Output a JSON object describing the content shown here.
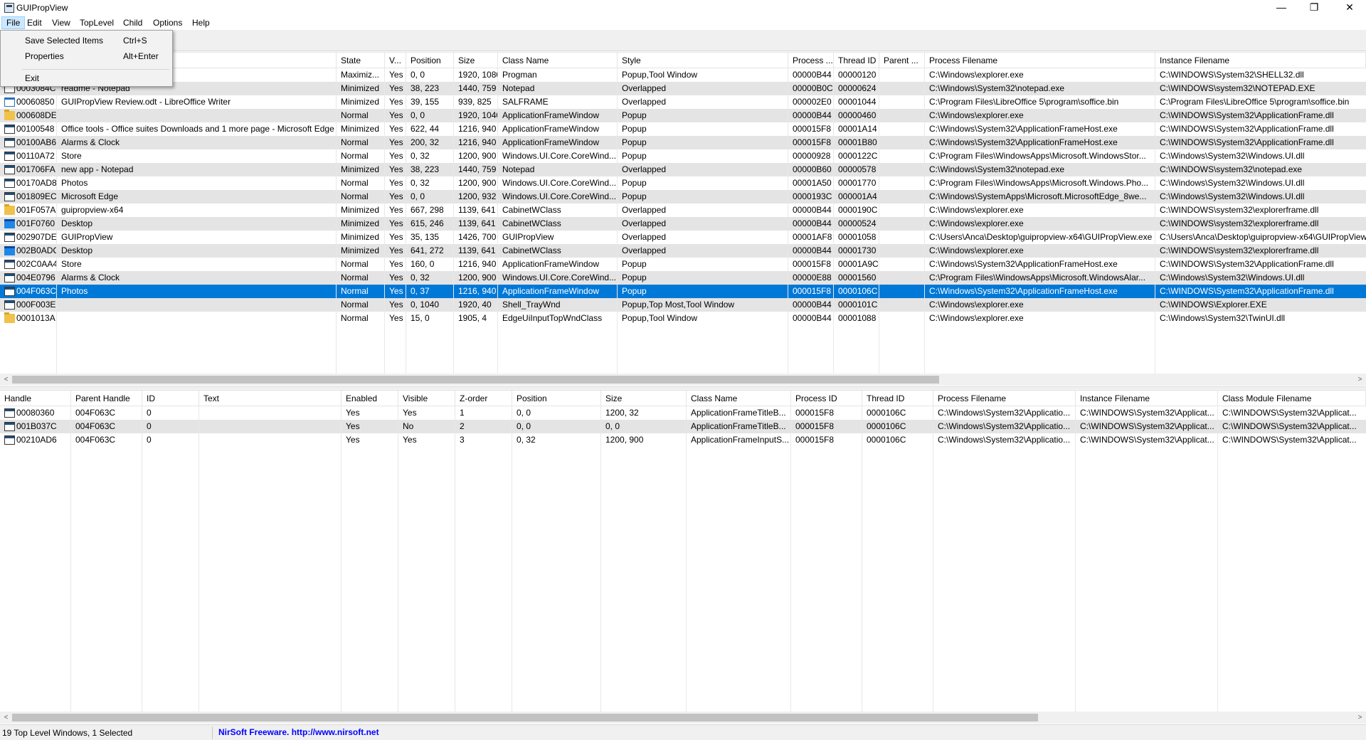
{
  "window": {
    "title": "GUIPropView",
    "minimize_glyph": "—",
    "maximize_glyph": "❐",
    "close_glyph": "✕"
  },
  "menubar": [
    "File",
    "Edit",
    "View",
    "TopLevel",
    "Child",
    "Options",
    "Help"
  ],
  "file_menu": {
    "items": [
      {
        "label": "Save Selected Items",
        "shortcut": "Ctrl+S"
      },
      {
        "label": "Properties",
        "shortcut": "Alt+Enter"
      },
      {
        "label": "Exit",
        "shortcut": ""
      }
    ]
  },
  "top_list": {
    "columns": [
      "",
      "",
      "State",
      "V...",
      "Position",
      "Size",
      "Class Name",
      "Style",
      "Process ...",
      "Thread ID",
      "Parent ...",
      "Process Filename",
      "Instance Filename"
    ],
    "rows": [
      {
        "icon": "window",
        "handle": "",
        "title": "",
        "state": "Maximiz...",
        "visible": "Yes",
        "position": "0, 0",
        "size": "1920, 1080",
        "class": "Progman",
        "style": "Popup,Tool Window",
        "pid": "00000B44",
        "tid": "00000120",
        "parent": "",
        "proc_file": "C:\\Windows\\explorer.exe",
        "inst_file": "C:\\WINDOWS\\System32\\SHELL32.dll"
      },
      {
        "icon": "window",
        "handle": "0003084C",
        "title": "readme - Notepad",
        "state": "Minimized",
        "visible": "Yes",
        "position": "38, 223",
        "size": "1440, 759",
        "class": "Notepad",
        "style": "Overlapped",
        "pid": "00000B0C",
        "tid": "00000624",
        "parent": "",
        "proc_file": "C:\\Windows\\System32\\notepad.exe",
        "inst_file": "C:\\WINDOWS\\system32\\NOTEPAD.EXE"
      },
      {
        "icon": "doc",
        "handle": "00060850",
        "title": "GUIPropView Review.odt - LibreOffice Writer",
        "state": "Minimized",
        "visible": "Yes",
        "position": "39, 155",
        "size": "939, 825",
        "class": "SALFRAME",
        "style": "Overlapped",
        "pid": "000002E0",
        "tid": "00001044",
        "parent": "",
        "proc_file": "C:\\Program Files\\LibreOffice 5\\program\\soffice.bin",
        "inst_file": "C:\\Program Files\\LibreOffice 5\\program\\soffice.bin"
      },
      {
        "icon": "folder",
        "handle": "000608DE",
        "title": "",
        "state": "Normal",
        "visible": "Yes",
        "position": "0, 0",
        "size": "1920, 1040",
        "class": "ApplicationFrameWindow",
        "style": "Popup",
        "pid": "00000B44",
        "tid": "00000460",
        "parent": "",
        "proc_file": "C:\\Windows\\explorer.exe",
        "inst_file": "C:\\WINDOWS\\System32\\ApplicationFrame.dll"
      },
      {
        "icon": "window",
        "handle": "00100548",
        "title": "Office tools - Office suites Downloads and 1 more page - Microsoft Edge",
        "state": "Minimized",
        "visible": "Yes",
        "position": "622, 44",
        "size": "1216, 940",
        "class": "ApplicationFrameWindow",
        "style": "Popup",
        "pid": "000015F8",
        "tid": "00001A14",
        "parent": "",
        "proc_file": "C:\\Windows\\System32\\ApplicationFrameHost.exe",
        "inst_file": "C:\\WINDOWS\\System32\\ApplicationFrame.dll"
      },
      {
        "icon": "window",
        "handle": "00100AB6",
        "title": "Alarms & Clock",
        "state": "Normal",
        "visible": "Yes",
        "position": "200, 32",
        "size": "1216, 940",
        "class": "ApplicationFrameWindow",
        "style": "Popup",
        "pid": "000015F8",
        "tid": "00001B80",
        "parent": "",
        "proc_file": "C:\\Windows\\System32\\ApplicationFrameHost.exe",
        "inst_file": "C:\\WINDOWS\\System32\\ApplicationFrame.dll"
      },
      {
        "icon": "window",
        "handle": "00110A72",
        "title": "Store",
        "state": "Normal",
        "visible": "Yes",
        "position": "0, 32",
        "size": "1200, 900",
        "class": "Windows.UI.Core.CoreWind...",
        "style": "Popup",
        "pid": "00000928",
        "tid": "0000122C",
        "parent": "",
        "proc_file": "C:\\Program Files\\WindowsApps\\Microsoft.WindowsStor...",
        "inst_file": "C:\\Windows\\System32\\Windows.UI.dll"
      },
      {
        "icon": "window",
        "handle": "001706FA",
        "title": "new app - Notepad",
        "state": "Minimized",
        "visible": "Yes",
        "position": "38, 223",
        "size": "1440, 759",
        "class": "Notepad",
        "style": "Overlapped",
        "pid": "00000B60",
        "tid": "00000578",
        "parent": "",
        "proc_file": "C:\\Windows\\System32\\notepad.exe",
        "inst_file": "C:\\WINDOWS\\system32\\notepad.exe"
      },
      {
        "icon": "window",
        "handle": "00170AD8",
        "title": "Photos",
        "state": "Normal",
        "visible": "Yes",
        "position": "0, 32",
        "size": "1200, 900",
        "class": "Windows.UI.Core.CoreWind...",
        "style": "Popup",
        "pid": "00001A50",
        "tid": "00001770",
        "parent": "",
        "proc_file": "C:\\Program Files\\WindowsApps\\Microsoft.Windows.Pho...",
        "inst_file": "C:\\Windows\\System32\\Windows.UI.dll"
      },
      {
        "icon": "window",
        "handle": "001809EC",
        "title": "Microsoft Edge",
        "state": "Normal",
        "visible": "Yes",
        "position": "0, 0",
        "size": "1200, 932",
        "class": "Windows.UI.Core.CoreWind...",
        "style": "Popup",
        "pid": "0000193C",
        "tid": "000001A4",
        "parent": "",
        "proc_file": "C:\\Windows\\SystemApps\\Microsoft.MicrosoftEdge_8we...",
        "inst_file": "C:\\Windows\\System32\\Windows.UI.dll"
      },
      {
        "icon": "folder",
        "handle": "001F057A",
        "title": "guipropview-x64",
        "state": "Minimized",
        "visible": "Yes",
        "position": "667, 298",
        "size": "1139, 641",
        "class": "CabinetWClass",
        "style": "Overlapped",
        "pid": "00000B44",
        "tid": "0000190C",
        "parent": "",
        "proc_file": "C:\\Windows\\explorer.exe",
        "inst_file": "C:\\WINDOWS\\system32\\explorerframe.dll"
      },
      {
        "icon": "desk",
        "handle": "001F0760",
        "title": "Desktop",
        "state": "Minimized",
        "visible": "Yes",
        "position": "615, 246",
        "size": "1139, 641",
        "class": "CabinetWClass",
        "style": "Overlapped",
        "pid": "00000B44",
        "tid": "00000524",
        "parent": "",
        "proc_file": "C:\\Windows\\explorer.exe",
        "inst_file": "C:\\WINDOWS\\system32\\explorerframe.dll"
      },
      {
        "icon": "window",
        "handle": "002907DE",
        "title": "GUIPropView",
        "state": "Minimized",
        "visible": "Yes",
        "position": "35, 135",
        "size": "1426, 700",
        "class": "GUIPropView",
        "style": "Overlapped",
        "pid": "00001AF8",
        "tid": "00001058",
        "parent": "",
        "proc_file": "C:\\Users\\Anca\\Desktop\\guipropview-x64\\GUIPropView.exe",
        "inst_file": "C:\\Users\\Anca\\Desktop\\guipropview-x64\\GUIPropView"
      },
      {
        "icon": "desk",
        "handle": "002B0ADC",
        "title": "Desktop",
        "state": "Minimized",
        "visible": "Yes",
        "position": "641, 272",
        "size": "1139, 641",
        "class": "CabinetWClass",
        "style": "Overlapped",
        "pid": "00000B44",
        "tid": "00001730",
        "parent": "",
        "proc_file": "C:\\Windows\\explorer.exe",
        "inst_file": "C:\\WINDOWS\\system32\\explorerframe.dll"
      },
      {
        "icon": "window",
        "handle": "002C0AA4",
        "title": "Store",
        "state": "Normal",
        "visible": "Yes",
        "position": "160, 0",
        "size": "1216, 940",
        "class": "ApplicationFrameWindow",
        "style": "Popup",
        "pid": "000015F8",
        "tid": "00001A9C",
        "parent": "",
        "proc_file": "C:\\Windows\\System32\\ApplicationFrameHost.exe",
        "inst_file": "C:\\WINDOWS\\System32\\ApplicationFrame.dll"
      },
      {
        "icon": "window",
        "handle": "004E0796",
        "title": "Alarms & Clock",
        "state": "Normal",
        "visible": "Yes",
        "position": "0, 32",
        "size": "1200, 900",
        "class": "Windows.UI.Core.CoreWind...",
        "style": "Popup",
        "pid": "00000E88",
        "tid": "00001560",
        "parent": "",
        "proc_file": "C:\\Program Files\\WindowsApps\\Microsoft.WindowsAlar...",
        "inst_file": "C:\\Windows\\System32\\Windows.UI.dll"
      },
      {
        "icon": "window",
        "handle": "004F063C",
        "title": "Photos",
        "state": "Normal",
        "visible": "Yes",
        "position": "0, 37",
        "size": "1216, 940",
        "class": "ApplicationFrameWindow",
        "style": "Popup",
        "pid": "000015F8",
        "tid": "0000106C",
        "parent": "",
        "proc_file": "C:\\Windows\\System32\\ApplicationFrameHost.exe",
        "inst_file": "C:\\WINDOWS\\System32\\ApplicationFrame.dll",
        "selected": true
      },
      {
        "icon": "window",
        "handle": "000F003E",
        "title": "",
        "state": "Normal",
        "visible": "Yes",
        "position": "0, 1040",
        "size": "1920, 40",
        "class": "Shell_TrayWnd",
        "style": "Popup,Top Most,Tool Window",
        "pid": "00000B44",
        "tid": "0000101C",
        "parent": "",
        "proc_file": "C:\\Windows\\explorer.exe",
        "inst_file": "C:\\WINDOWS\\Explorer.EXE"
      },
      {
        "icon": "folder",
        "handle": "0001013A",
        "title": "",
        "state": "Normal",
        "visible": "Yes",
        "position": "15, 0",
        "size": "1905, 4",
        "class": "EdgeUiInputTopWndClass",
        "style": "Popup,Tool Window",
        "pid": "00000B44",
        "tid": "00001088",
        "parent": "",
        "proc_file": "C:\\Windows\\explorer.exe",
        "inst_file": "C:\\Windows\\System32\\TwinUI.dll"
      }
    ]
  },
  "bottom_list": {
    "columns": [
      "Handle",
      "Parent Handle",
      "ID",
      "Text",
      "Enabled",
      "Visible",
      "Z-order",
      "Position",
      "Size",
      "Class Name",
      "Process ID",
      "Thread ID",
      "Process Filename",
      "Instance Filename",
      "Class Module Filename"
    ],
    "sort_glyph": "/",
    "rows": [
      {
        "handle": "00080360",
        "parent": "004F063C",
        "id": "0",
        "text": "",
        "enabled": "Yes",
        "visible": "Yes",
        "zorder": "1",
        "position": "0, 0",
        "size": "1200, 32",
        "class": "ApplicationFrameTitleB...",
        "pid": "000015F8",
        "tid": "0000106C",
        "proc_file": "C:\\Windows\\System32\\Applicatio...",
        "inst_file": "C:\\WINDOWS\\System32\\Applicat...",
        "cls_file": "C:\\WINDOWS\\System32\\Applicat..."
      },
      {
        "handle": "001B037C",
        "parent": "004F063C",
        "id": "0",
        "text": "",
        "enabled": "Yes",
        "visible": "No",
        "zorder": "2",
        "position": "0, 0",
        "size": "0, 0",
        "class": "ApplicationFrameTitleB...",
        "pid": "000015F8",
        "tid": "0000106C",
        "proc_file": "C:\\Windows\\System32\\Applicatio...",
        "inst_file": "C:\\WINDOWS\\System32\\Applicat...",
        "cls_file": "C:\\WINDOWS\\System32\\Applicat..."
      },
      {
        "handle": "00210AD6",
        "parent": "004F063C",
        "id": "0",
        "text": "",
        "enabled": "Yes",
        "visible": "Yes",
        "zorder": "3",
        "position": "0, 32",
        "size": "1200, 900",
        "class": "ApplicationFrameInputS...",
        "pid": "000015F8",
        "tid": "0000106C",
        "proc_file": "C:\\Windows\\System32\\Applicatio...",
        "inst_file": "C:\\WINDOWS\\System32\\Applicat...",
        "cls_file": "C:\\WINDOWS\\System32\\Applicat..."
      }
    ]
  },
  "scroll": {
    "left_arrow": "<",
    "right_arrow": ">"
  },
  "statusbar": {
    "summary": "19 Top Level Windows, 1 Selected",
    "link": "NirSoft Freeware.  http://www.nirsoft.net"
  },
  "colors": {
    "selection": "#0078d7",
    "alt_row": "#e4e4e4",
    "link": "#0000ff"
  }
}
